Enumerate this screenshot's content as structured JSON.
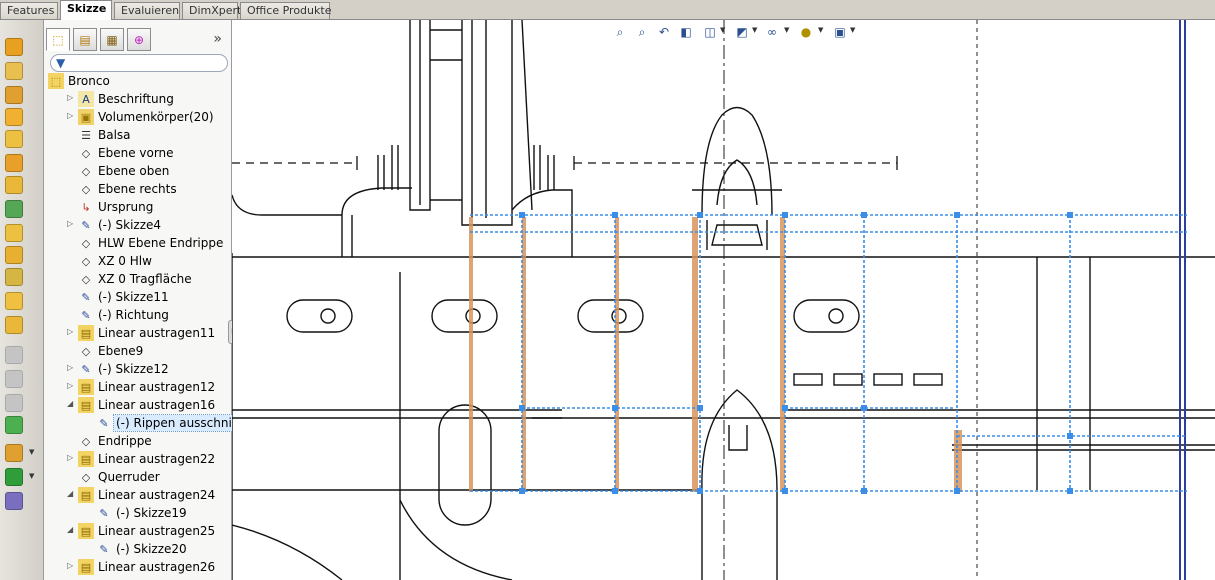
{
  "tabs": [
    "Features",
    "Skizze",
    "Evaluieren",
    "DimXpert",
    "Office Produkte"
  ],
  "active_tab": "Skizze",
  "feature_tree": {
    "root": "Bronco",
    "items": [
      {
        "label": "Beschriftung",
        "icon": "annotation-icon"
      },
      {
        "label": "Volumenkörper(20)",
        "icon": "solid-bodies-icon"
      },
      {
        "label": "Balsa",
        "icon": "material-icon"
      },
      {
        "label": "Ebene vorne",
        "icon": "plane-icon"
      },
      {
        "label": "Ebene oben",
        "icon": "plane-icon"
      },
      {
        "label": "Ebene rechts",
        "icon": "plane-icon"
      },
      {
        "label": "Ursprung",
        "icon": "origin-icon"
      },
      {
        "label": "(-) Skizze4",
        "icon": "sketch-icon"
      },
      {
        "label": "HLW Ebene Endrippe",
        "icon": "plane-icon"
      },
      {
        "label": "XZ 0 Hlw",
        "icon": "plane-icon"
      },
      {
        "label": "XZ 0 Tragfläche",
        "icon": "plane-icon"
      },
      {
        "label": "(-) Skizze11",
        "icon": "sketch-icon"
      },
      {
        "label": "(-) Richtung",
        "icon": "sketch-icon"
      },
      {
        "label": "Linear austragen11",
        "icon": "extrude-icon"
      },
      {
        "label": "Ebene9",
        "icon": "plane-icon"
      },
      {
        "label": "(-) Skizze12",
        "icon": "sketch-icon"
      },
      {
        "label": "Linear austragen12",
        "icon": "extrude-icon"
      },
      {
        "label": "Linear austragen16",
        "icon": "extrude-icon"
      },
      {
        "label": "(-) Rippen ausschnitte",
        "icon": "sketch-icon"
      },
      {
        "label": "Endrippe",
        "icon": "plane-icon"
      },
      {
        "label": "Linear austragen22",
        "icon": "extrude-icon"
      },
      {
        "label": "Querruder",
        "icon": "plane-icon"
      },
      {
        "label": "Linear austragen24",
        "icon": "extrude-icon"
      },
      {
        "label": "(-) Skizze19",
        "icon": "sketch-icon"
      },
      {
        "label": "Linear austragen25",
        "icon": "extrude-icon"
      },
      {
        "label": "(-) Skizze20",
        "icon": "sketch-icon"
      },
      {
        "label": "Linear austragen26",
        "icon": "extrude-icon"
      }
    ]
  },
  "fm_tab_icons": [
    "feature-manager-icon",
    "property-manager-icon",
    "configuration-manager-icon",
    "dim-xpert-manager-icon"
  ],
  "heads_up_icons": [
    "zoom-to-fit-icon",
    "zoom-area-icon",
    "previous-view-icon",
    "section-view-icon",
    "view-orientation-icon",
    "display-style-icon",
    "hide-show-icon",
    "appearance-icon",
    "scene-icon"
  ],
  "colors": {
    "selection_blue": "#3b8ee8",
    "rib_orange": "#d9945a",
    "active_tab_bg": "#ffffff",
    "selected_row_bg": "#d9ecff"
  }
}
